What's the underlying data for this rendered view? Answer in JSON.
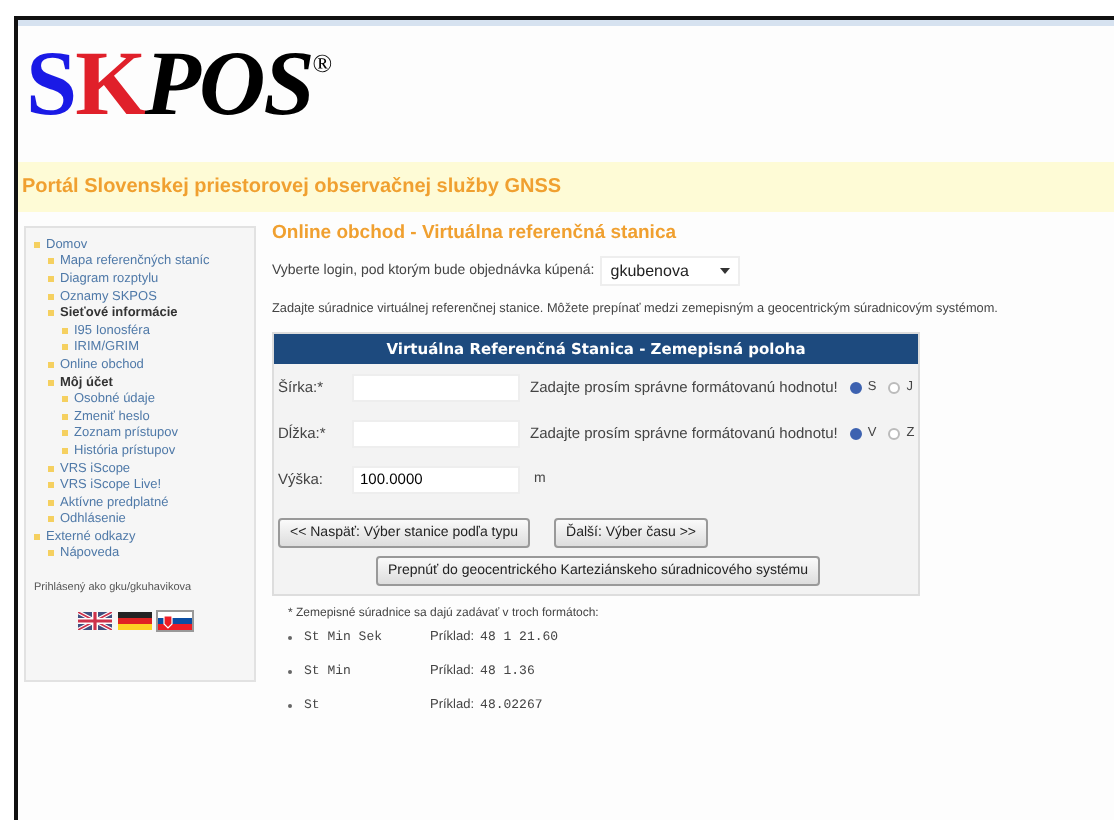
{
  "logo": {
    "letters": [
      {
        "text": "S",
        "color": "#1a1ae6"
      },
      {
        "text": "K",
        "color": "#e0202a"
      },
      {
        "text": "POS",
        "color": "#000000"
      }
    ],
    "mark": "®"
  },
  "banner": "Portál Slovenskej priestorovej observačnej služby GNSS",
  "sidebar": {
    "items": [
      {
        "label": "Domov",
        "kind": "link",
        "children": [
          {
            "label": "Mapa referenčných staníc",
            "kind": "link"
          },
          {
            "label": "Diagram rozptylu",
            "kind": "link"
          },
          {
            "label": "Oznamy SKPOS",
            "kind": "link"
          },
          {
            "label": "Sieťové informácie",
            "kind": "heading",
            "children": [
              {
                "label": "I95 Ionosféra",
                "kind": "link"
              },
              {
                "label": "IRIM/GRIM",
                "kind": "link"
              }
            ]
          },
          {
            "label": "Online obchod",
            "kind": "link"
          },
          {
            "label": "Môj účet",
            "kind": "heading",
            "children": [
              {
                "label": "Osobné údaje",
                "kind": "link"
              },
              {
                "label": "Zmeniť heslo",
                "kind": "link"
              },
              {
                "label": "Zoznam prístupov",
                "kind": "link"
              },
              {
                "label": "História prístupov",
                "kind": "link"
              }
            ]
          },
          {
            "label": "VRS iScope",
            "kind": "link"
          },
          {
            "label": "VRS iScope Live!",
            "kind": "link"
          },
          {
            "label": "Aktívne predplatné",
            "kind": "link"
          },
          {
            "label": "Odhlásenie",
            "kind": "link"
          }
        ]
      },
      {
        "label": "Externé odkazy",
        "kind": "link",
        "children": [
          {
            "label": "Nápoveda",
            "kind": "link"
          }
        ]
      }
    ],
    "logged_in": "Prihlásený ako gku/gkuhavikova",
    "flags": [
      {
        "kind": "uk",
        "selected": false
      },
      {
        "kind": "de",
        "selected": false
      },
      {
        "kind": "sk",
        "selected": true
      }
    ]
  },
  "main": {
    "title": "Online obchod - Virtuálna referenčná stanica",
    "login_label": "Vyberte login, pod ktorým bude objednávka kúpená:",
    "login_value": "gkubenova",
    "intro": "Zadajte súradnice virtuálnej referenčnej stanice. Môžete prepínať medzi zemepisným a geocentrickým súradnicovým systémom.",
    "form": {
      "title": "Virtuálna Referenčná Stanica - Zemepisná poloha",
      "fields": [
        {
          "label": "Šírka:*",
          "hint": "Zadajte prosím správne formátovanú hodnotu!",
          "options": [
            {
              "label": "S",
              "selected": true
            },
            {
              "label": "J",
              "selected": false
            }
          ]
        },
        {
          "label": "Dĺžka:*",
          "hint": "Zadajte prosím správne formátovanú hodnotu!",
          "options": [
            {
              "label": "V",
              "selected": true
            },
            {
              "label": "Z",
              "selected": false
            }
          ]
        },
        {
          "label": "Výška:",
          "value": "100.0000",
          "unit": "m"
        }
      ],
      "buttons": [
        "<< Naspäť: Výber stanice podľa typu",
        "Ďalší: Výber času >>"
      ],
      "switch_button": "Prepnúť do geocentrického Karteziánskeho súradnicového systému"
    },
    "note": "* Zemepisné súradnice sa dajú zadávať v troch formátoch:",
    "formats": [
      {
        "name": "St Min Sek",
        "example_label": "Príklad:",
        "example": "48 1 21.60"
      },
      {
        "name": "St Min",
        "example_label": "Príklad:",
        "example": "48 1.36"
      },
      {
        "name": "St",
        "example_label": "Príklad:",
        "example": "48.02267"
      }
    ]
  }
}
